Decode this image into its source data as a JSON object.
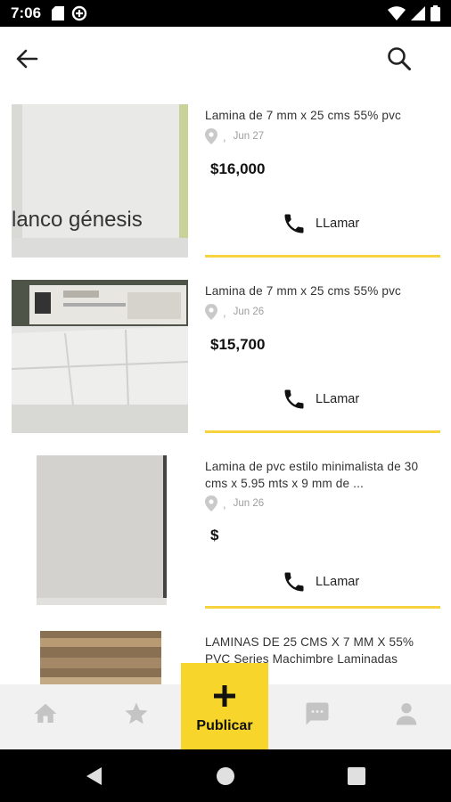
{
  "status_bar": {
    "time": "7:06",
    "left_icons": [
      "sd-card-icon",
      "data-saver-icon"
    ],
    "right_icons": [
      "wifi-icon",
      "signal-icon",
      "battery-icon"
    ]
  },
  "app_bar": {
    "back_icon": "back-arrow-icon",
    "search_icon": "search-icon"
  },
  "listings": [
    {
      "title": "Lamina de 7 mm x 25 cms 55% pvc",
      "location": ",",
      "date": "Jun 27",
      "price": "$16,000",
      "call_label": "LLamar",
      "thumb_caption": "lanco génesis"
    },
    {
      "title": "Lamina de 7 mm x 25 cms 55% pvc",
      "location": ",",
      "date": "Jun 26",
      "price": "$15,700",
      "call_label": "LLamar"
    },
    {
      "title": "Lamina de pvc estilo minimalista de 30 cms x 5.95 mts x 9 mm de ...",
      "location": ",",
      "date": "Jun 26",
      "price": "$",
      "call_label": "LLamar"
    },
    {
      "title": "LAMINAS DE 25 CMS X 7 MM X 55% PVC Series Machimbre Laminadas"
    }
  ],
  "bottom_nav": {
    "items": [
      "home-icon",
      "star-icon",
      "chat-icon",
      "profile-icon"
    ],
    "publish_label": "Publicar",
    "accent_color": "#f7d52a"
  },
  "system_nav": [
    "back-triangle-icon",
    "home-circle-icon",
    "recents-square-icon"
  ]
}
